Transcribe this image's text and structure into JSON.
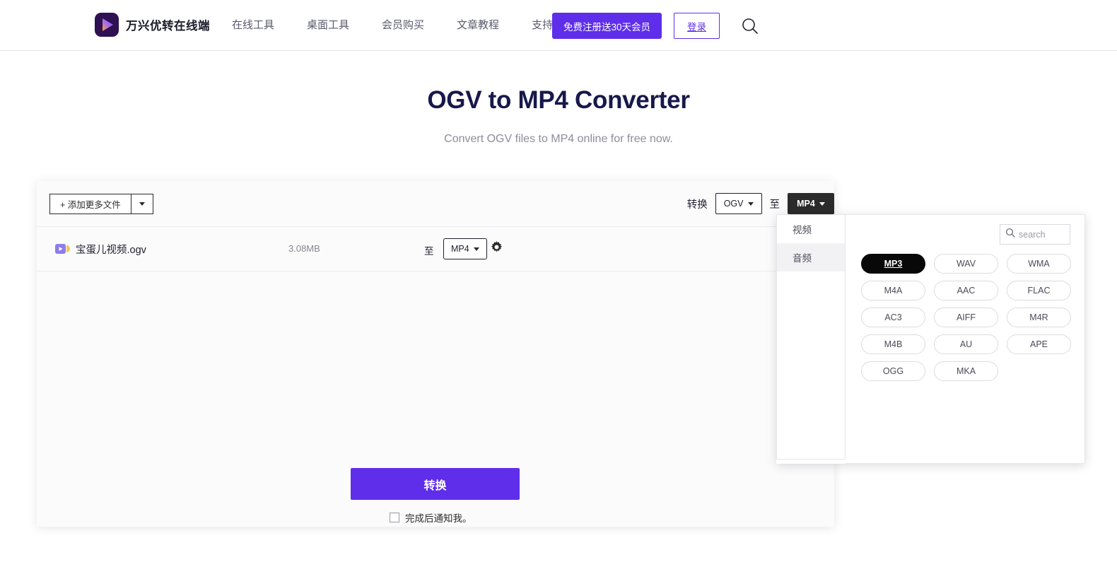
{
  "header": {
    "brand_name": "万兴优转在线端",
    "logo_icon": "play-logo-icon",
    "nav": [
      {
        "label": "在线工具"
      },
      {
        "label": "桌面工具"
      },
      {
        "label": "会员购买"
      },
      {
        "label": "文章教程"
      },
      {
        "label": "支持帮助"
      }
    ],
    "signup_label": "免费注册送30天会员",
    "login_label": "登录",
    "search_icon": "search-icon",
    "accent_color": "#5f2eea"
  },
  "hero": {
    "title": "OGV to MP4 Converter",
    "subtitle": "Convert OGV files to MP4 online for free now.",
    "title_color": "#17184b"
  },
  "panel": {
    "add_files_label": "+ 添加更多文件",
    "add_files_caret": "chevron-down-icon",
    "convert_label": "转换",
    "source_format": "OGV",
    "to_label": "至",
    "target_format": "MP4",
    "file": {
      "icon": "video-file-icon",
      "name": "宝蛋儿视频.ogv",
      "size": "3.08MB",
      "to_label": "至",
      "format": "MP4",
      "settings_icon": "gear-icon"
    },
    "convert_button_label": "转换",
    "notify_label": "完成后通知我。",
    "notify_checked": false
  },
  "dropdown": {
    "categories": [
      {
        "label": "视频",
        "active": false
      },
      {
        "label": "音频",
        "active": true
      }
    ],
    "search_placeholder": "search",
    "search_icon": "search-icon",
    "selected_format": "MP3",
    "formats": [
      "MP3",
      "WAV",
      "WMA",
      "M4A",
      "AAC",
      "FLAC",
      "AC3",
      "AIFF",
      "M4R",
      "M4B",
      "AU",
      "APE",
      "OGG",
      "MKA"
    ]
  }
}
